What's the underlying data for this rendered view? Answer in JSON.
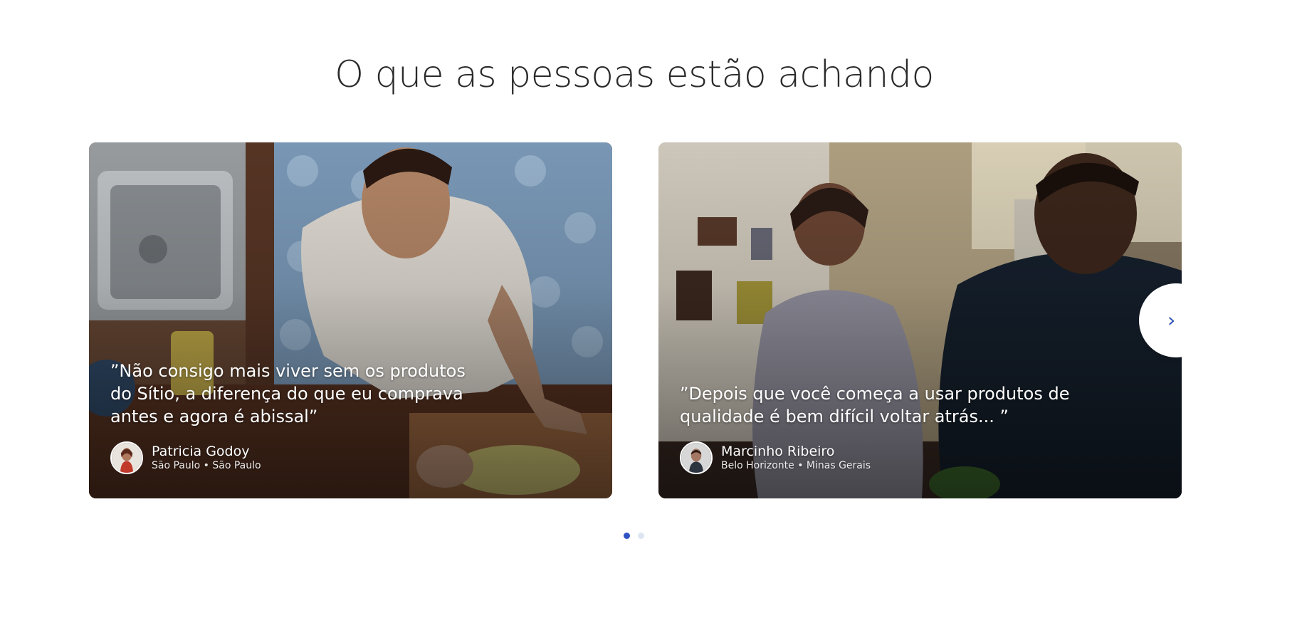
{
  "section": {
    "title": "O que as pessoas estão achando"
  },
  "testimonials": [
    {
      "quote": "”Não consigo mais viver sem os produtos do Sítio, a diferença do que eu comprava antes e agora é abissal”",
      "name": "Patricia Godoy",
      "location": "São Paulo • São Paulo"
    },
    {
      "quote": "”Depois que você começa a usar produtos de qualidade é bem difícil voltar atrás... ”",
      "name": "Marcinho Ribeiro",
      "location": "Belo Horizonte • Minas Gerais"
    }
  ],
  "carousel": {
    "next_icon": "chevron-right-icon",
    "next_symbol": "›",
    "pages": 2,
    "active_page": 1
  },
  "colors": {
    "accent": "#2f53c4",
    "dot_inactive": "#dde6f0",
    "title_text": "#2a2a2a"
  }
}
